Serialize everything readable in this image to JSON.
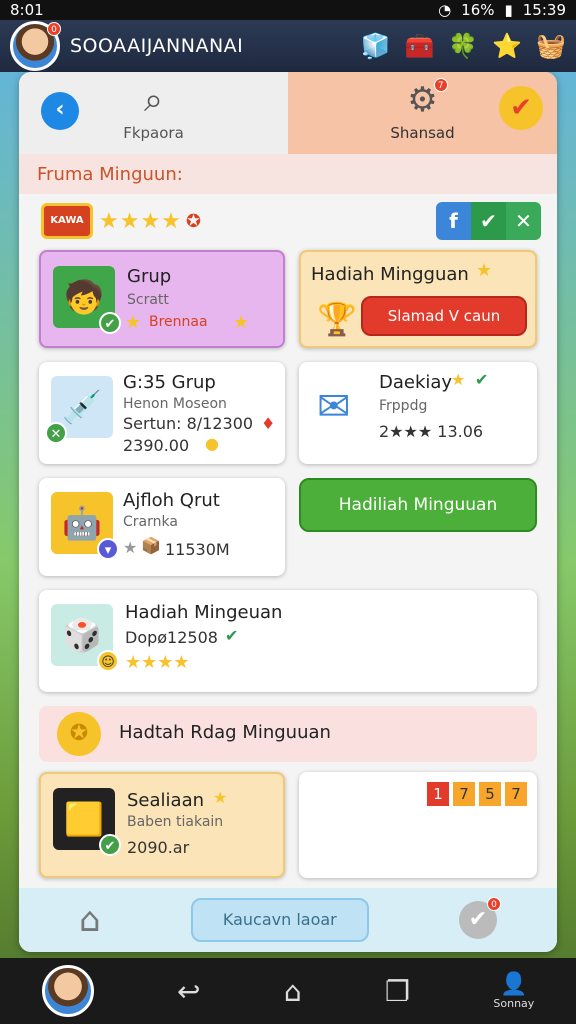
{
  "status": {
    "time_left": "8:01",
    "battery": "16%",
    "clock": "15:39"
  },
  "header": {
    "username": "SOOAAIJANNANAI"
  },
  "tabs": {
    "left_label": "Fkpaora",
    "right_label": "Shansad",
    "right_badge": "7"
  },
  "section": {
    "title": "Fruma Minguun:"
  },
  "rating": {
    "logo_text": "KAWA",
    "stars": "★★★★",
    "share": [
      "f",
      "✔",
      "✕"
    ]
  },
  "cards": {
    "group": {
      "title": "Grup",
      "sub": "Scratt",
      "label": "Brennaa"
    },
    "reward": {
      "title": "Hadiah Mingguan",
      "button": "Slamad V caun"
    },
    "g35": {
      "title": "G:35 Grup",
      "sub": "Henon Moseon",
      "line": "Sertun: 8/12300",
      "value": "2390.00"
    },
    "daily": {
      "title": "Daekiay",
      "sub": "Frppdg",
      "rating": "2★★★ 13.06"
    },
    "robot": {
      "title": "Ajfloh Qrut",
      "sub": "Crarnka",
      "value": "11530M"
    },
    "green_button": "Hadiliah Minguuan",
    "weekly": {
      "title": "Hadiah Mingeuan",
      "value": "Dopø12508",
      "stars": "★★★★"
    },
    "banner": {
      "title": "Hadtah Rdag Minguuan"
    },
    "item": {
      "title": "Sealiaan",
      "sub": "Baben tiakain",
      "value": "2090.ar"
    },
    "numbers": [
      "1",
      "7",
      "5",
      "7"
    ]
  },
  "bottom": {
    "action_label": "Kaucavn laoar"
  },
  "nav": {
    "profile_label": "Sonnay"
  }
}
